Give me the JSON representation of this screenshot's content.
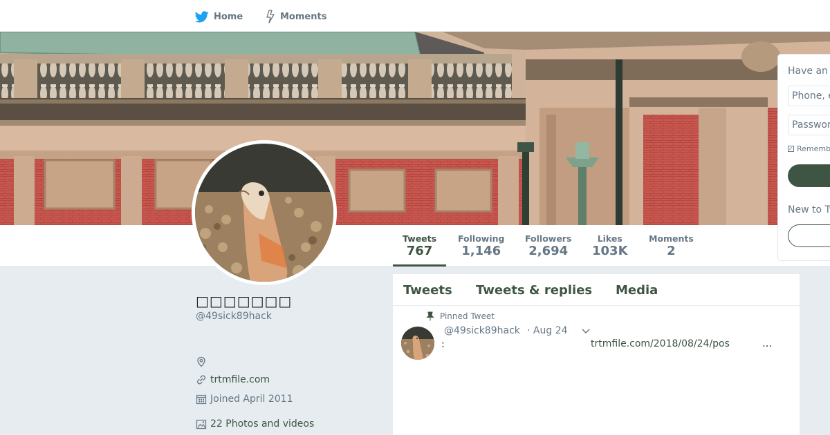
{
  "nav": {
    "home_label": "Home",
    "moments_label": "Moments",
    "accent": "#1da1f2"
  },
  "profile": {
    "name": "□□□□□□□",
    "handle": "@49sick89hack",
    "url": "trtmfile.com",
    "joined": "Joined April 2011",
    "photos": "22 Photos and videos"
  },
  "stats": [
    {
      "label": "Tweets",
      "value": "767"
    },
    {
      "label": "Following",
      "value": "1,146"
    },
    {
      "label": "Followers",
      "value": "2,694"
    },
    {
      "label": "Likes",
      "value": "103K"
    },
    {
      "label": "Moments",
      "value": "2"
    }
  ],
  "timeline": {
    "tabs": [
      "Tweets",
      "Tweets & replies",
      "Media"
    ],
    "pinned_label": "Pinned Tweet",
    "tweet": {
      "handle": "@49sick89hack",
      "date": "· Aug 24",
      "text_prefix": ":",
      "link": "trtmfile.com/2018/08/24/pos",
      "ellipsis": "…"
    }
  },
  "login": {
    "heading": "Have an account?",
    "phone_placeholder": "Phone, email, or username",
    "password_placeholder": "Password",
    "remember": "Remember me",
    "new_heading": "New to Twitter?"
  },
  "colors": {
    "theme": "#3e5543",
    "muted": "#657786",
    "page_bg": "#e6ecf0"
  }
}
